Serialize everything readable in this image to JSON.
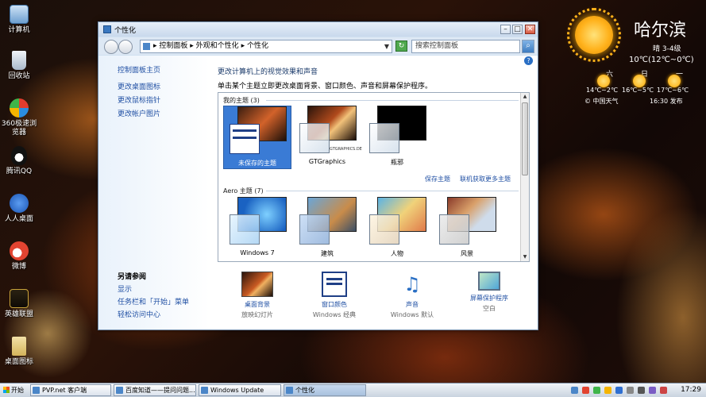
{
  "desktop_icons": [
    {
      "label": "计算机",
      "icon": "computer-icon",
      "color": "#8fb4d9"
    },
    {
      "label": "回收站",
      "icon": "recycle-bin-icon",
      "color": "#c8d6e4"
    },
    {
      "label": "360极速浏览器",
      "icon": "360-browser-icon",
      "color": "#e04a3a"
    },
    {
      "label": "腾讯QQ",
      "icon": "qq-icon",
      "color": "#1a1a1a"
    },
    {
      "label": "人人桌面",
      "icon": "renren-icon",
      "color": "#2f6fd1"
    },
    {
      "label": "微博",
      "icon": "weibo-icon",
      "color": "#e24431"
    },
    {
      "label": "英雄联盟",
      "icon": "lol-icon",
      "color": "#c9a43a"
    },
    {
      "label": "桌面图标",
      "icon": "folder-icon",
      "color": "#e0c16a"
    }
  ],
  "weather": {
    "city": "哈尔滨",
    "condition": "晴 3-4级",
    "temp": "10℃(12℃~0℃)",
    "days": [
      {
        "day": "六",
        "range": "14℃~2℃"
      },
      {
        "day": "日",
        "range": "16℃~5℃"
      },
      {
        "day": "一",
        "range": "17℃~6℃"
      }
    ],
    "source": "© 中国天气",
    "publish": "16:30 发布"
  },
  "window": {
    "title": "个性化",
    "address": [
      "控制面板",
      "外观和个性化",
      "个性化"
    ],
    "search_placeholder": "搜索控制面板",
    "left_links": [
      "控制面板主页",
      "更改桌面图标",
      "更改鼠标指针",
      "更改帐户图片"
    ],
    "see_also_title": "另请参阅",
    "see_also": [
      "显示",
      "任务栏和「开始」菜单",
      "轻松访问中心"
    ],
    "main_title": "更改计算机上的视觉效果和声音",
    "main_sub": "单击某个主题立即更改桌面背景、窗口颜色、声音和屏幕保护程序。",
    "my_themes_title": "我的主题 (3)",
    "my_themes": [
      "未保存的主题",
      "GTGraphics",
      "瓶邪"
    ],
    "save_theme": "保存主题",
    "get_more": "联机获取更多主题",
    "aero_title": "Aero 主题 (7)",
    "aero_themes": [
      "Windows 7",
      "建筑",
      "人物",
      "风景"
    ],
    "bottom": [
      {
        "label": "桌面背景",
        "sub": "放映幻灯片"
      },
      {
        "label": "窗口颜色",
        "sub": "Windows 经典"
      },
      {
        "label": "声音",
        "sub": "Windows 默认"
      },
      {
        "label": "屏幕保护程序",
        "sub": "空白"
      }
    ],
    "gtgraphics_watermark": "GTGRAPHICS.DE"
  },
  "taskbar": {
    "start": "开始",
    "items": [
      "PVP.net 客户端",
      "百度知道——提问问题...",
      "Windows Update",
      "个性化"
    ],
    "clock": "17:29"
  }
}
